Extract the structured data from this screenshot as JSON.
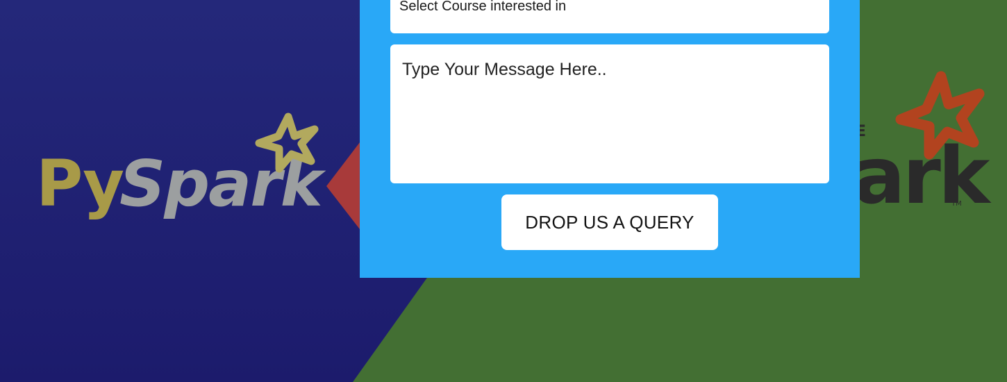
{
  "background": {
    "left_logo_text": "PySpark",
    "right_logo_text": "ark",
    "colors": {
      "left_bg": "#1f2274",
      "right_bg": "#436f33",
      "panel": "#29a8f7"
    }
  },
  "form": {
    "course_select_value": "Select Course interested in",
    "message_placeholder": "Type Your Message Here..",
    "submit_label": "DROP US A QUERY"
  }
}
